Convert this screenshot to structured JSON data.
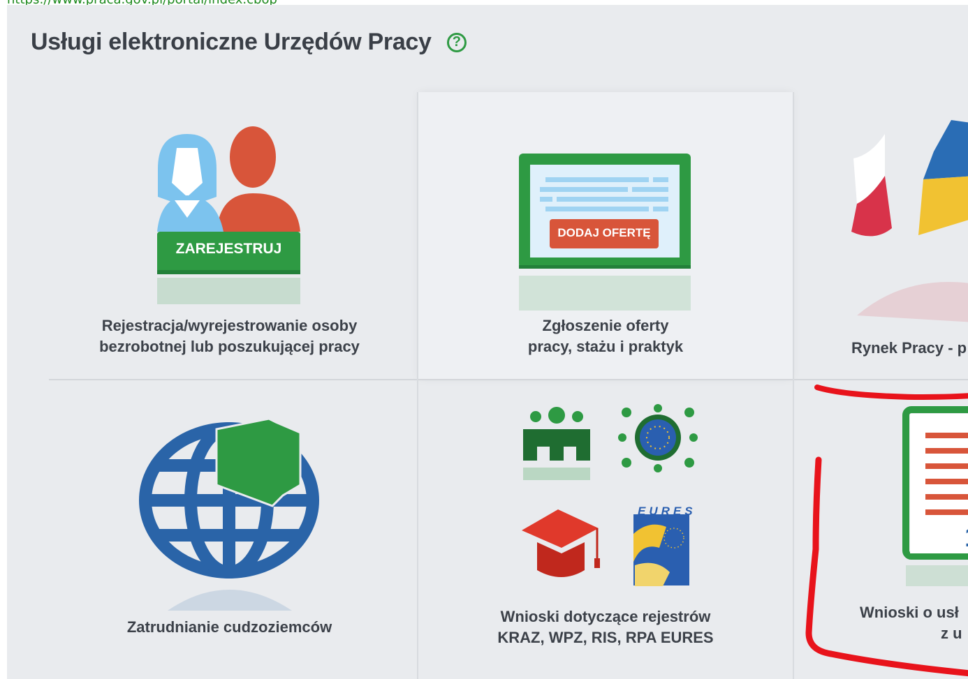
{
  "url": "https://www.praca.gov.pl/portal/index.cbop",
  "title": "Usługi elektroniczne Urzędów Pracy",
  "help_icon": "?",
  "tiles": [
    {
      "id": "register",
      "button_text": "ZAREJESTRUJ",
      "label_line1": "Rejestracja/wyrejestrowanie osoby",
      "label_line2": "bezrobotnej lub poszukującej pracy",
      "icon": "people-icon"
    },
    {
      "id": "offer",
      "button_text": "DODAJ OFERTĘ",
      "label_line1": "Zgłoszenie oferty",
      "label_line2": "pracy, stażu i praktyk",
      "icon": "monitor-icon"
    },
    {
      "id": "market",
      "label_line1": "Rynek Pracy - p",
      "icon": "flags-icon"
    },
    {
      "id": "foreigners",
      "label_line1": "Zatrudnianie cudzoziemców",
      "icon": "globe-icon"
    },
    {
      "id": "registries",
      "label_line1": "Wnioski dotyczące rejestrów",
      "label_line2": "KRAZ, WPZ, RIS, RPA EURES",
      "eures_text": "EURES",
      "icon": "registries-icon"
    },
    {
      "id": "services",
      "label_line1": "Wnioski o usł",
      "label_line2": "z u",
      "icon": "document-icon"
    }
  ],
  "colors": {
    "green": "#2e9a43",
    "red": "#d8553a",
    "blue": "#2a6db5",
    "highlight": "#e8131b"
  }
}
